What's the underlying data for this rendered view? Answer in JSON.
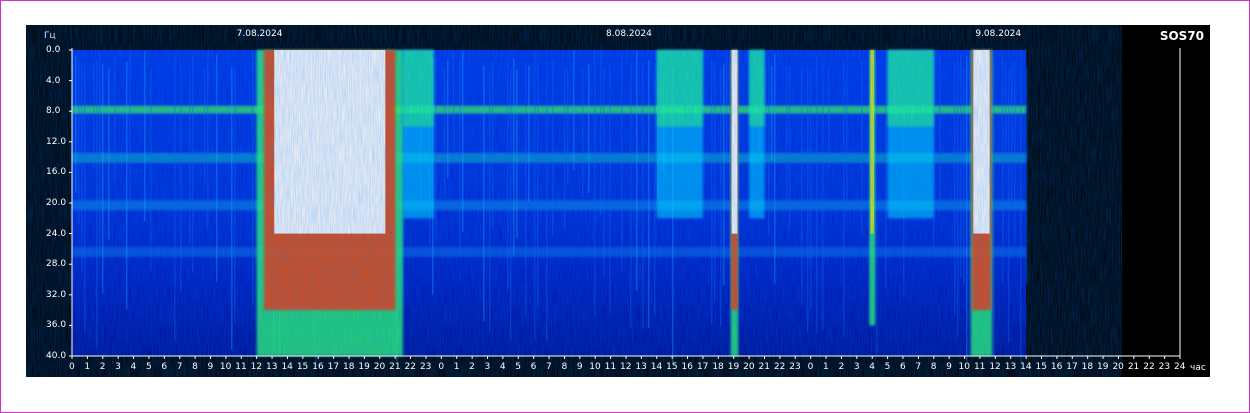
{
  "chart_data": {
    "type": "heatmap",
    "title": "SOS70",
    "ylabel": "Гц",
    "xlabel": "час",
    "ylim": [
      0,
      40
    ],
    "yticks": [
      "0.0",
      "4.0",
      "8.0",
      "12.0",
      "16.0",
      "20.0",
      "24.0",
      "28.0",
      "32.0",
      "36.0",
      "40.0"
    ],
    "dates": [
      {
        "label": "7.08.2024",
        "hour": 12
      },
      {
        "label": "8.08.2024",
        "hour": 36
      },
      {
        "label": "9.08.2024",
        "hour": 60
      }
    ],
    "xticks": [
      "0",
      "1",
      "2",
      "3",
      "4",
      "5",
      "6",
      "7",
      "8",
      "9",
      "10",
      "11",
      "12",
      "13",
      "14",
      "15",
      "16",
      "17",
      "18",
      "19",
      "20",
      "21",
      "22",
      "23",
      "0",
      "1",
      "2",
      "3",
      "4",
      "5",
      "6",
      "7",
      "8",
      "9",
      "10",
      "11",
      "12",
      "13",
      "14",
      "15",
      "16",
      "17",
      "18",
      "19",
      "20",
      "21",
      "22",
      "23",
      "0",
      "1",
      "2",
      "3",
      "4",
      "5",
      "6",
      "7",
      "8",
      "9",
      "10",
      "11",
      "12",
      "13",
      "14",
      "15",
      "16",
      "17",
      "18",
      "19",
      "20",
      "21",
      "22",
      "23",
      "24"
    ],
    "x_range_hours": [
      0,
      72
    ],
    "data_end_hour": 62,
    "resonance_bands_hz": [
      7.8,
      14.1,
      20.3,
      26.4
    ],
    "intense_periods_hours": [
      {
        "start": 12,
        "end": 21.5,
        "intensity": 1.0
      },
      {
        "start": 21.5,
        "end": 23.5,
        "intensity": 0.55
      },
      {
        "start": 38,
        "end": 41,
        "intensity": 0.55
      },
      {
        "start": 42.8,
        "end": 43.3,
        "intensity": 0.95
      },
      {
        "start": 44,
        "end": 45,
        "intensity": 0.5
      },
      {
        "start": 51.8,
        "end": 52.2,
        "intensity": 0.8
      },
      {
        "start": 53,
        "end": 56,
        "intensity": 0.5
      },
      {
        "start": 58.4,
        "end": 59.8,
        "intensity": 0.95
      }
    ],
    "colors": [
      "#000070",
      "#0010c8",
      "#0070ff",
      "#00e8ff",
      "#30ff60",
      "#ffe000",
      "#ff3000",
      "#ffffff"
    ]
  }
}
